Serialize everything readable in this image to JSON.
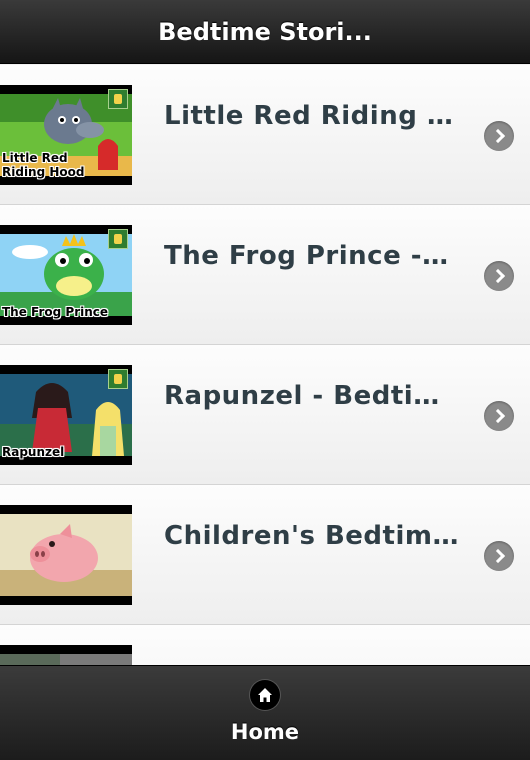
{
  "header": {
    "title": "Bedtime Stori..."
  },
  "list": {
    "items": [
      {
        "title": "Little Red Riding Hoo...",
        "thumb_caption": "Little Red\nRiding Hood",
        "thumb_icon": "wolf-and-girl-icon"
      },
      {
        "title": "The Frog Prince -Bed...",
        "thumb_caption": "The Frog Prince",
        "thumb_icon": "frog-prince-icon"
      },
      {
        "title": "Rapunzel - Bedtime S...",
        "thumb_caption": "Rapunzel",
        "thumb_icon": "rapunzel-icon"
      },
      {
        "title": "Children's Bedtime S...",
        "thumb_caption": "",
        "thumb_icon": "pig-icon"
      },
      {
        "title": "",
        "thumb_caption": "",
        "thumb_icon": "partial-thumbnail"
      }
    ]
  },
  "footer": {
    "home_label": "Home",
    "home_icon": "home-icon"
  },
  "colors": {
    "header_bg": "#1e1e1e",
    "title_text": "#2f3e46",
    "chevron": "#8a8a8a",
    "footer_bg": "#262626"
  }
}
